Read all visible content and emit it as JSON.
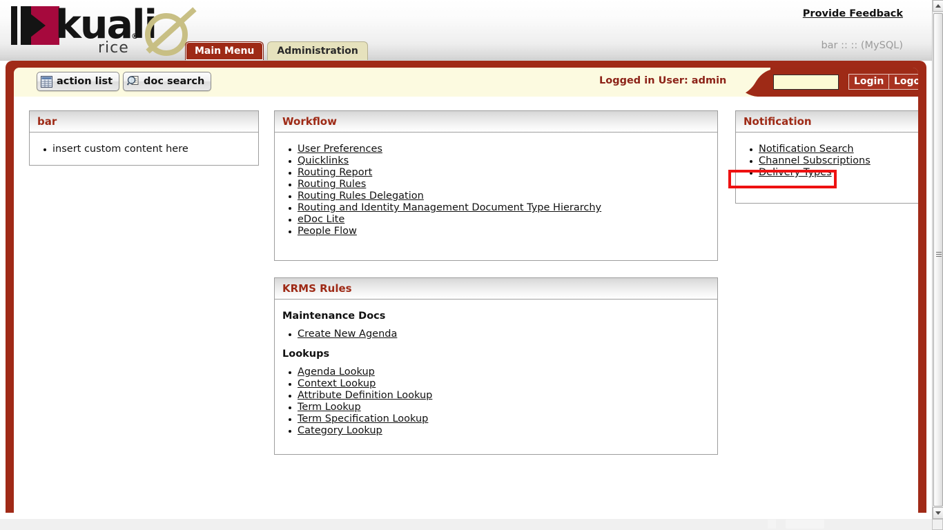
{
  "masthead": {
    "logo": {
      "word": "kuali",
      "registered": "®",
      "sub": "rice",
      "symbol_icon": "kuali-slashed-circle-icon"
    },
    "provide_feedback": "Provide Feedback",
    "environment": "bar :: :: (MySQL)"
  },
  "tabs": [
    {
      "label": "Main Menu",
      "active": true
    },
    {
      "label": "Administration",
      "active": false
    }
  ],
  "toolbar": {
    "action_list_label": "action list",
    "action_list_icon": "table-grid-icon",
    "doc_search_label": "doc search",
    "doc_search_icon": "magnifier-document-icon",
    "logged_in_user": "Logged in User: admin",
    "login_value": "",
    "login_placeholder": "",
    "login_label": "Login",
    "logout_label": "Logout"
  },
  "panels": {
    "bar": {
      "title": "bar",
      "items": [
        "insert custom content here"
      ]
    },
    "workflow": {
      "title": "Workflow",
      "links": [
        "User Preferences",
        "Quicklinks",
        "Routing Report",
        "Routing Rules",
        "Routing Rules Delegation",
        "Routing and Identity Management Document Type Hierarchy",
        "eDoc Lite",
        "People Flow"
      ]
    },
    "krms": {
      "title": "KRMS Rules",
      "maintenance_heading": "Maintenance Docs",
      "maintenance_links": [
        "Create New Agenda"
      ],
      "lookups_heading": "Lookups",
      "lookups_links": [
        "Agenda Lookup",
        "Context Lookup",
        "Attribute Definition Lookup",
        "Term Lookup",
        "Term Specification Lookup",
        "Category Lookup"
      ]
    },
    "notification": {
      "title": "Notification",
      "links": [
        "Notification Search",
        "Channel Subscriptions",
        "Delivery Types"
      ]
    }
  },
  "annotation": {
    "highlight_target": "Delivery Types",
    "highlight_color": "#ee1111"
  },
  "colors": {
    "brand_red": "#9e2a16",
    "frame_red": "#a02a17",
    "cream": "#fcfae0",
    "tab_inactive": "#e6e2bd",
    "logo_crimson": "#a6093d",
    "logo_khaki": "#c8bf84"
  }
}
